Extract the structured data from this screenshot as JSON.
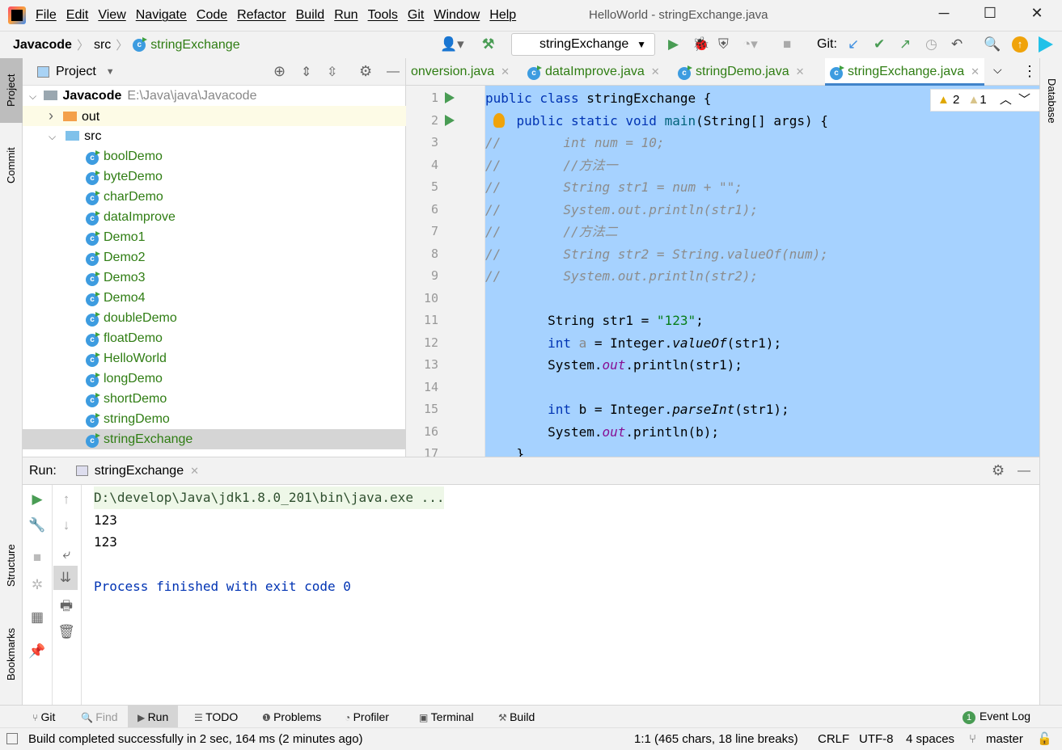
{
  "app": {
    "title": "HelloWorld - stringExchange.java"
  },
  "menu": [
    "File",
    "Edit",
    "View",
    "Navigate",
    "Code",
    "Refactor",
    "Build",
    "Run",
    "Tools",
    "Git",
    "Window",
    "Help"
  ],
  "breadcrumb": [
    "Javacode",
    "src",
    "stringExchange"
  ],
  "toolbar": {
    "run_config": "stringExchange",
    "git_label": "Git:"
  },
  "left_strip": [
    "Project",
    "Commit",
    "Structure",
    "Bookmarks"
  ],
  "right_strip": [
    "Database"
  ],
  "project": {
    "header": "Project",
    "root": {
      "name": "Javacode",
      "path": "E:\\Java\\java\\Javacode"
    },
    "folders": [
      "out",
      "src"
    ],
    "classes": [
      "boolDemo",
      "byteDemo",
      "charDemo",
      "dataImprove",
      "Demo1",
      "Demo2",
      "Demo3",
      "Demo4",
      "doubleDemo",
      "floatDemo",
      "HelloWorld",
      "longDemo",
      "shortDemo",
      "stringDemo",
      "stringExchange"
    ],
    "selected": "stringExchange"
  },
  "editor": {
    "tabs": [
      "onversion.java",
      "dataImprove.java",
      "stringDemo.java",
      "stringExchange.java"
    ],
    "active_tab": "stringExchange.java",
    "inspections": {
      "warnings": "2",
      "weak_warnings": "1"
    },
    "lines": [
      [
        [
          "kw",
          "public class "
        ],
        [
          "",
          "stringExchange {"
        ]
      ],
      [
        [
          "",
          "    "
        ],
        [
          "kw",
          "public static void "
        ],
        [
          "fn",
          "main"
        ],
        [
          "",
          "(String[] args) {"
        ]
      ],
      [
        [
          "cm",
          "//        int num = 10;"
        ]
      ],
      [
        [
          "cm",
          "//        //方法一"
        ]
      ],
      [
        [
          "cm",
          "//        String str1 = num + \"\";"
        ]
      ],
      [
        [
          "cm",
          "//        System.out.println(str1);"
        ]
      ],
      [
        [
          "cm",
          "//        //方法二"
        ]
      ],
      [
        [
          "cm",
          "//        String str2 = String.valueOf(num);"
        ]
      ],
      [
        [
          "cm",
          "//        System.out.println(str2);"
        ]
      ],
      [],
      [
        [
          "",
          "        String str1 = "
        ],
        [
          "st",
          "\"123\""
        ],
        [
          "",
          ";"
        ]
      ],
      [
        [
          "kw",
          "        int "
        ],
        [
          "un",
          "a"
        ],
        [
          "",
          " = Integer."
        ],
        [
          "it",
          "valueOf"
        ],
        [
          "",
          "(str1);"
        ]
      ],
      [
        [
          "",
          "        System."
        ],
        [
          "fd",
          "out"
        ],
        [
          "",
          ".println(str1);"
        ]
      ],
      [],
      [
        [
          "kw",
          "        int "
        ],
        [
          "",
          "b = Integer."
        ],
        [
          "it",
          "parseInt"
        ],
        [
          "",
          "(str1);"
        ]
      ],
      [
        [
          "",
          "        System."
        ],
        [
          "fd",
          "out"
        ],
        [
          "",
          ".println(b);"
        ]
      ],
      [
        [
          "",
          "    }"
        ]
      ]
    ]
  },
  "run": {
    "label": "Run:",
    "tab": "stringExchange",
    "output": [
      "D:\\develop\\Java\\jdk1.8.0_201\\bin\\java.exe ...",
      "123",
      "123",
      "",
      "Process finished with exit code 0"
    ]
  },
  "tool_windows": [
    "Git",
    "Find",
    "Run",
    "TODO",
    "Problems",
    "Profiler",
    "Terminal",
    "Build"
  ],
  "event_log": {
    "count": "1",
    "label": "Event Log"
  },
  "status": {
    "message": "Build completed successfully in 2 sec, 164 ms (2 minutes ago)",
    "position": "1:1 (465 chars, 18 line breaks)",
    "line_sep": "CRLF",
    "encoding": "UTF-8",
    "indent": "4 spaces",
    "branch": "master"
  },
  "colors": {
    "selection": "#a6d2ff",
    "keyword": "#0033b3",
    "string": "#067d17",
    "class_name": "#2f7d13",
    "run_green": "#499c54"
  }
}
